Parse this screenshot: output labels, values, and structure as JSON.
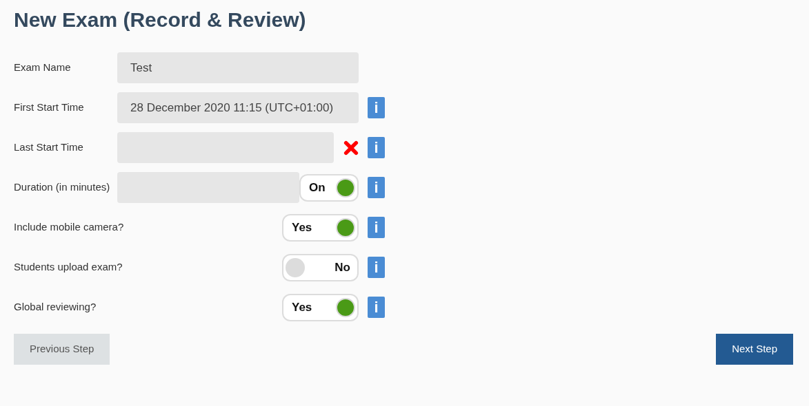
{
  "title": "New Exam (Record & Review)",
  "rows": [
    {
      "label": "Exam Name",
      "value": "Test"
    },
    {
      "label": "First Start Time",
      "value": "28 December 2020 11:15 (UTC+01:00)",
      "info": "i"
    },
    {
      "label": "Last Start Time",
      "clearable": true,
      "info": "i"
    },
    {
      "label": "Duration (in minutes)",
      "toggle": {
        "label": "On",
        "on": true
      },
      "info": "i"
    },
    {
      "label": "Include mobile camera?",
      "field": false,
      "toggle": {
        "label": "Yes",
        "on": true
      },
      "info": "i"
    },
    {
      "label": "Students upload exam?",
      "field": false,
      "toggle": {
        "label": "No",
        "on": false
      },
      "info": "i"
    },
    {
      "label": "Global reviewing?",
      "field": false,
      "toggle": {
        "label": "Yes",
        "on": true
      },
      "info": "i"
    }
  ],
  "buttons": {
    "previous": "Previous Step",
    "next": "Next Step"
  }
}
